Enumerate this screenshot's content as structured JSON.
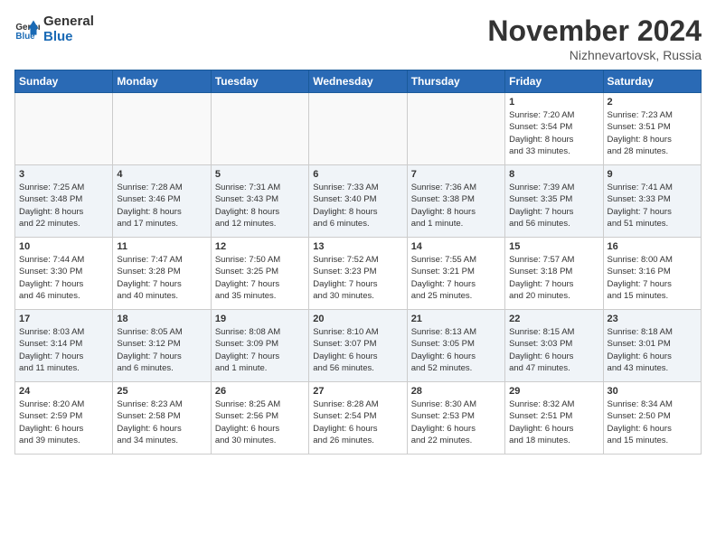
{
  "header": {
    "logo_line1": "General",
    "logo_line2": "Blue",
    "month_year": "November 2024",
    "location": "Nizhnevartovsk, Russia"
  },
  "days_of_week": [
    "Sunday",
    "Monday",
    "Tuesday",
    "Wednesday",
    "Thursday",
    "Friday",
    "Saturday"
  ],
  "weeks": [
    [
      {
        "day": "",
        "content": ""
      },
      {
        "day": "",
        "content": ""
      },
      {
        "day": "",
        "content": ""
      },
      {
        "day": "",
        "content": ""
      },
      {
        "day": "",
        "content": ""
      },
      {
        "day": "1",
        "content": "Sunrise: 7:20 AM\nSunset: 3:54 PM\nDaylight: 8 hours\nand 33 minutes."
      },
      {
        "day": "2",
        "content": "Sunrise: 7:23 AM\nSunset: 3:51 PM\nDaylight: 8 hours\nand 28 minutes."
      }
    ],
    [
      {
        "day": "3",
        "content": "Sunrise: 7:25 AM\nSunset: 3:48 PM\nDaylight: 8 hours\nand 22 minutes."
      },
      {
        "day": "4",
        "content": "Sunrise: 7:28 AM\nSunset: 3:46 PM\nDaylight: 8 hours\nand 17 minutes."
      },
      {
        "day": "5",
        "content": "Sunrise: 7:31 AM\nSunset: 3:43 PM\nDaylight: 8 hours\nand 12 minutes."
      },
      {
        "day": "6",
        "content": "Sunrise: 7:33 AM\nSunset: 3:40 PM\nDaylight: 8 hours\nand 6 minutes."
      },
      {
        "day": "7",
        "content": "Sunrise: 7:36 AM\nSunset: 3:38 PM\nDaylight: 8 hours\nand 1 minute."
      },
      {
        "day": "8",
        "content": "Sunrise: 7:39 AM\nSunset: 3:35 PM\nDaylight: 7 hours\nand 56 minutes."
      },
      {
        "day": "9",
        "content": "Sunrise: 7:41 AM\nSunset: 3:33 PM\nDaylight: 7 hours\nand 51 minutes."
      }
    ],
    [
      {
        "day": "10",
        "content": "Sunrise: 7:44 AM\nSunset: 3:30 PM\nDaylight: 7 hours\nand 46 minutes."
      },
      {
        "day": "11",
        "content": "Sunrise: 7:47 AM\nSunset: 3:28 PM\nDaylight: 7 hours\nand 40 minutes."
      },
      {
        "day": "12",
        "content": "Sunrise: 7:50 AM\nSunset: 3:25 PM\nDaylight: 7 hours\nand 35 minutes."
      },
      {
        "day": "13",
        "content": "Sunrise: 7:52 AM\nSunset: 3:23 PM\nDaylight: 7 hours\nand 30 minutes."
      },
      {
        "day": "14",
        "content": "Sunrise: 7:55 AM\nSunset: 3:21 PM\nDaylight: 7 hours\nand 25 minutes."
      },
      {
        "day": "15",
        "content": "Sunrise: 7:57 AM\nSunset: 3:18 PM\nDaylight: 7 hours\nand 20 minutes."
      },
      {
        "day": "16",
        "content": "Sunrise: 8:00 AM\nSunset: 3:16 PM\nDaylight: 7 hours\nand 15 minutes."
      }
    ],
    [
      {
        "day": "17",
        "content": "Sunrise: 8:03 AM\nSunset: 3:14 PM\nDaylight: 7 hours\nand 11 minutes."
      },
      {
        "day": "18",
        "content": "Sunrise: 8:05 AM\nSunset: 3:12 PM\nDaylight: 7 hours\nand 6 minutes."
      },
      {
        "day": "19",
        "content": "Sunrise: 8:08 AM\nSunset: 3:09 PM\nDaylight: 7 hours\nand 1 minute."
      },
      {
        "day": "20",
        "content": "Sunrise: 8:10 AM\nSunset: 3:07 PM\nDaylight: 6 hours\nand 56 minutes."
      },
      {
        "day": "21",
        "content": "Sunrise: 8:13 AM\nSunset: 3:05 PM\nDaylight: 6 hours\nand 52 minutes."
      },
      {
        "day": "22",
        "content": "Sunrise: 8:15 AM\nSunset: 3:03 PM\nDaylight: 6 hours\nand 47 minutes."
      },
      {
        "day": "23",
        "content": "Sunrise: 8:18 AM\nSunset: 3:01 PM\nDaylight: 6 hours\nand 43 minutes."
      }
    ],
    [
      {
        "day": "24",
        "content": "Sunrise: 8:20 AM\nSunset: 2:59 PM\nDaylight: 6 hours\nand 39 minutes."
      },
      {
        "day": "25",
        "content": "Sunrise: 8:23 AM\nSunset: 2:58 PM\nDaylight: 6 hours\nand 34 minutes."
      },
      {
        "day": "26",
        "content": "Sunrise: 8:25 AM\nSunset: 2:56 PM\nDaylight: 6 hours\nand 30 minutes."
      },
      {
        "day": "27",
        "content": "Sunrise: 8:28 AM\nSunset: 2:54 PM\nDaylight: 6 hours\nand 26 minutes."
      },
      {
        "day": "28",
        "content": "Sunrise: 8:30 AM\nSunset: 2:53 PM\nDaylight: 6 hours\nand 22 minutes."
      },
      {
        "day": "29",
        "content": "Sunrise: 8:32 AM\nSunset: 2:51 PM\nDaylight: 6 hours\nand 18 minutes."
      },
      {
        "day": "30",
        "content": "Sunrise: 8:34 AM\nSunset: 2:50 PM\nDaylight: 6 hours\nand 15 minutes."
      }
    ]
  ]
}
